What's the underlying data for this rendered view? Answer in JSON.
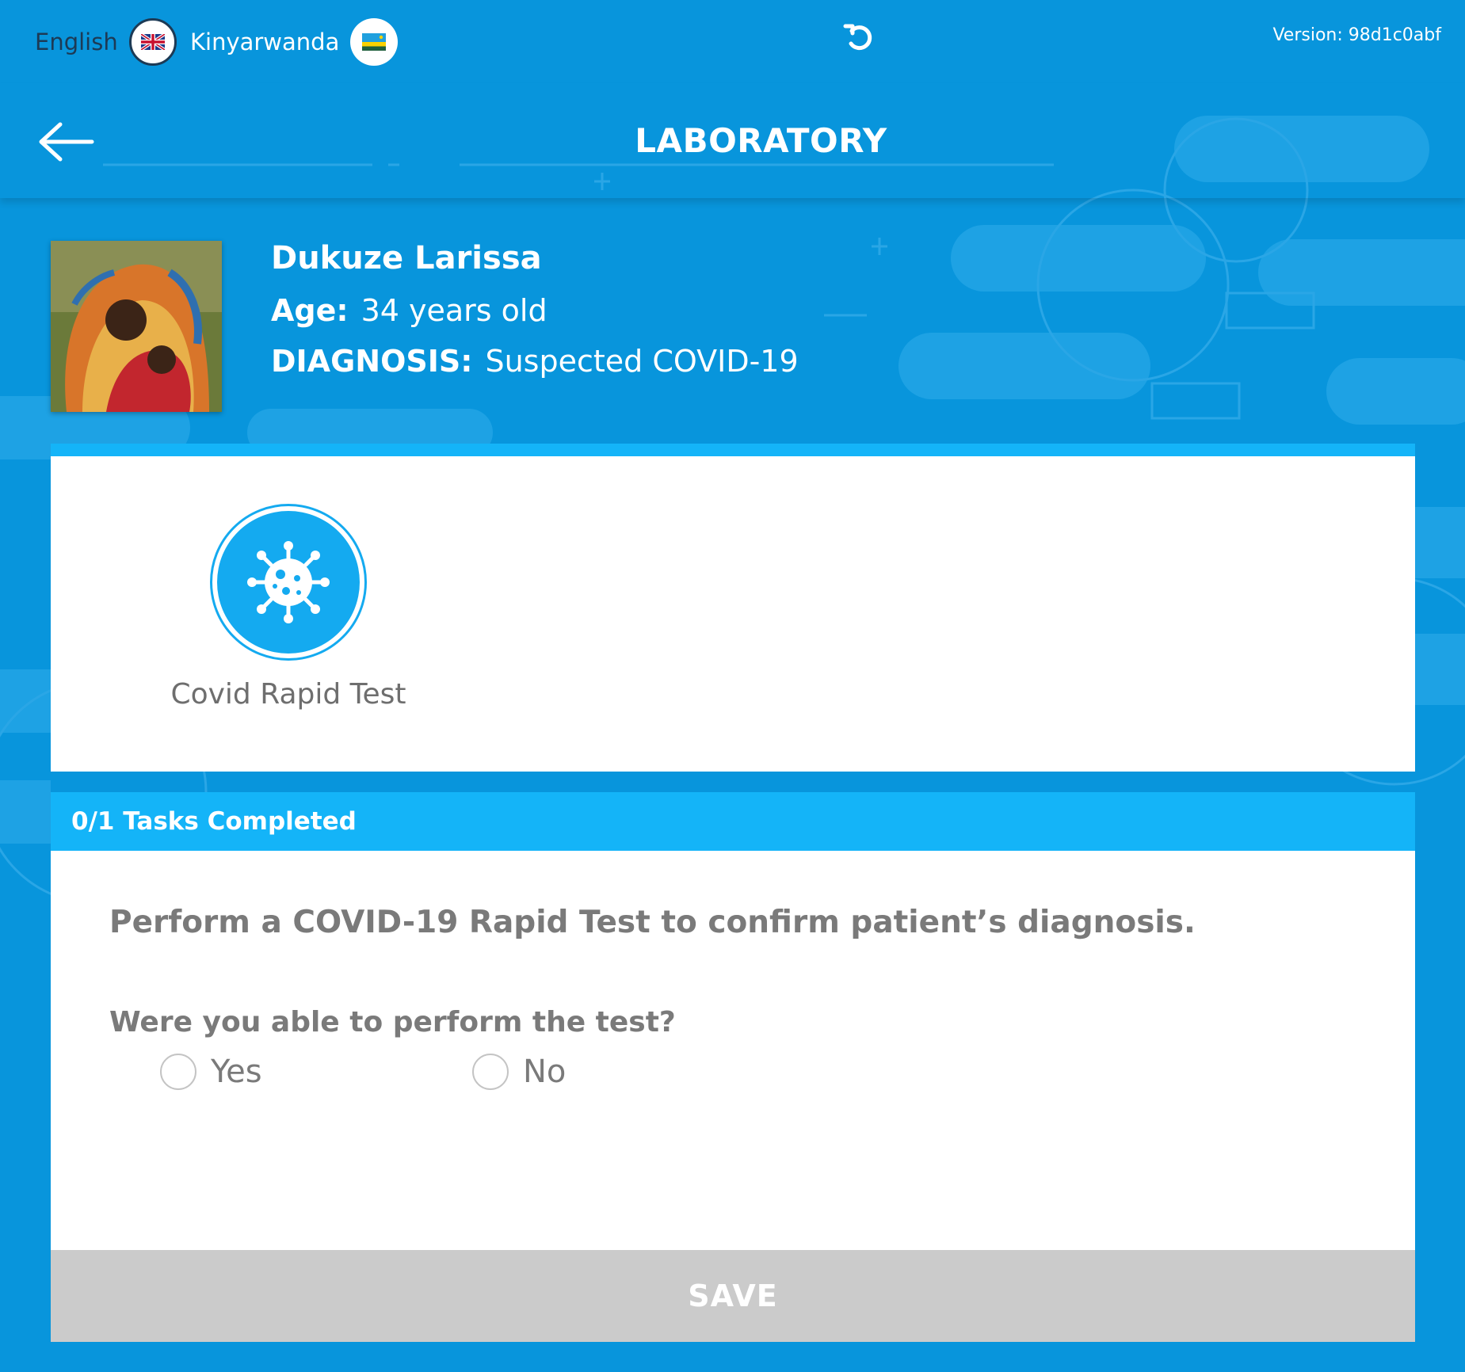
{
  "languages": [
    {
      "label": "English",
      "flag": "uk-flag-icon",
      "selected": true
    },
    {
      "label": "Kinyarwanda",
      "flag": "rwanda-flag-icon",
      "selected": false
    }
  ],
  "version": "Version: 98d1c0abf",
  "header": {
    "title": "LABORATORY"
  },
  "patient": {
    "name": "Dukuze Larissa",
    "age_label": "Age:",
    "age_value": "34 years old",
    "diagnosis_label": "DIAGNOSIS:",
    "diagnosis_value": "Suspected COVID-19"
  },
  "tests": [
    {
      "label": "Covid Rapid Test",
      "icon": "virus-icon"
    }
  ],
  "tasks": {
    "progress": "0/1 Tasks Completed",
    "instruction": "Perform a COVID-19 Rapid Test to confirm patient’s diagnosis.",
    "question": "Were you able to perform the test?",
    "options": [
      "Yes",
      "No"
    ]
  },
  "save_label": "SAVE",
  "colors": {
    "background": "#0895dc",
    "accent": "#14b4f8",
    "save_disabled": "#cbcbcb",
    "text_gray": "#7a7a7a"
  }
}
